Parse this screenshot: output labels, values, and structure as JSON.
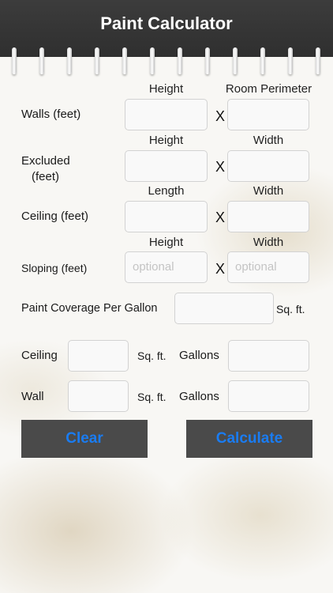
{
  "app": {
    "title": "Paint Calculator"
  },
  "rows": {
    "walls": {
      "label": "Walls (feet)",
      "col1": "Height",
      "col2": "Room Perimeter",
      "times": "X"
    },
    "excluded": {
      "label_line1": "Excluded",
      "label_line2": "(feet)",
      "col1": "Height",
      "col2": "Width",
      "times": "X"
    },
    "ceiling": {
      "label": "Ceiling (feet)",
      "col1": "Length",
      "col2": "Width",
      "times": "X"
    },
    "sloping": {
      "label": "Sloping (feet)",
      "col1": "Height",
      "col2": "Width",
      "times": "X",
      "placeholder1": "optional",
      "placeholder2": "optional"
    }
  },
  "coverage": {
    "label": "Paint Coverage Per Gallon",
    "unit": "Sq. ft."
  },
  "results": {
    "ceiling": {
      "label": "Ceiling",
      "unit": "Sq. ft.",
      "gallons_label": "Gallons"
    },
    "wall": {
      "label": "Wall",
      "unit": "Sq. ft.",
      "gallons_label": "Gallons"
    }
  },
  "buttons": {
    "clear": "Clear",
    "calculate": "Calculate"
  },
  "colors": {
    "header": "#333333",
    "button_bg": "#4a4a4a",
    "button_text": "#1a7cf2"
  }
}
